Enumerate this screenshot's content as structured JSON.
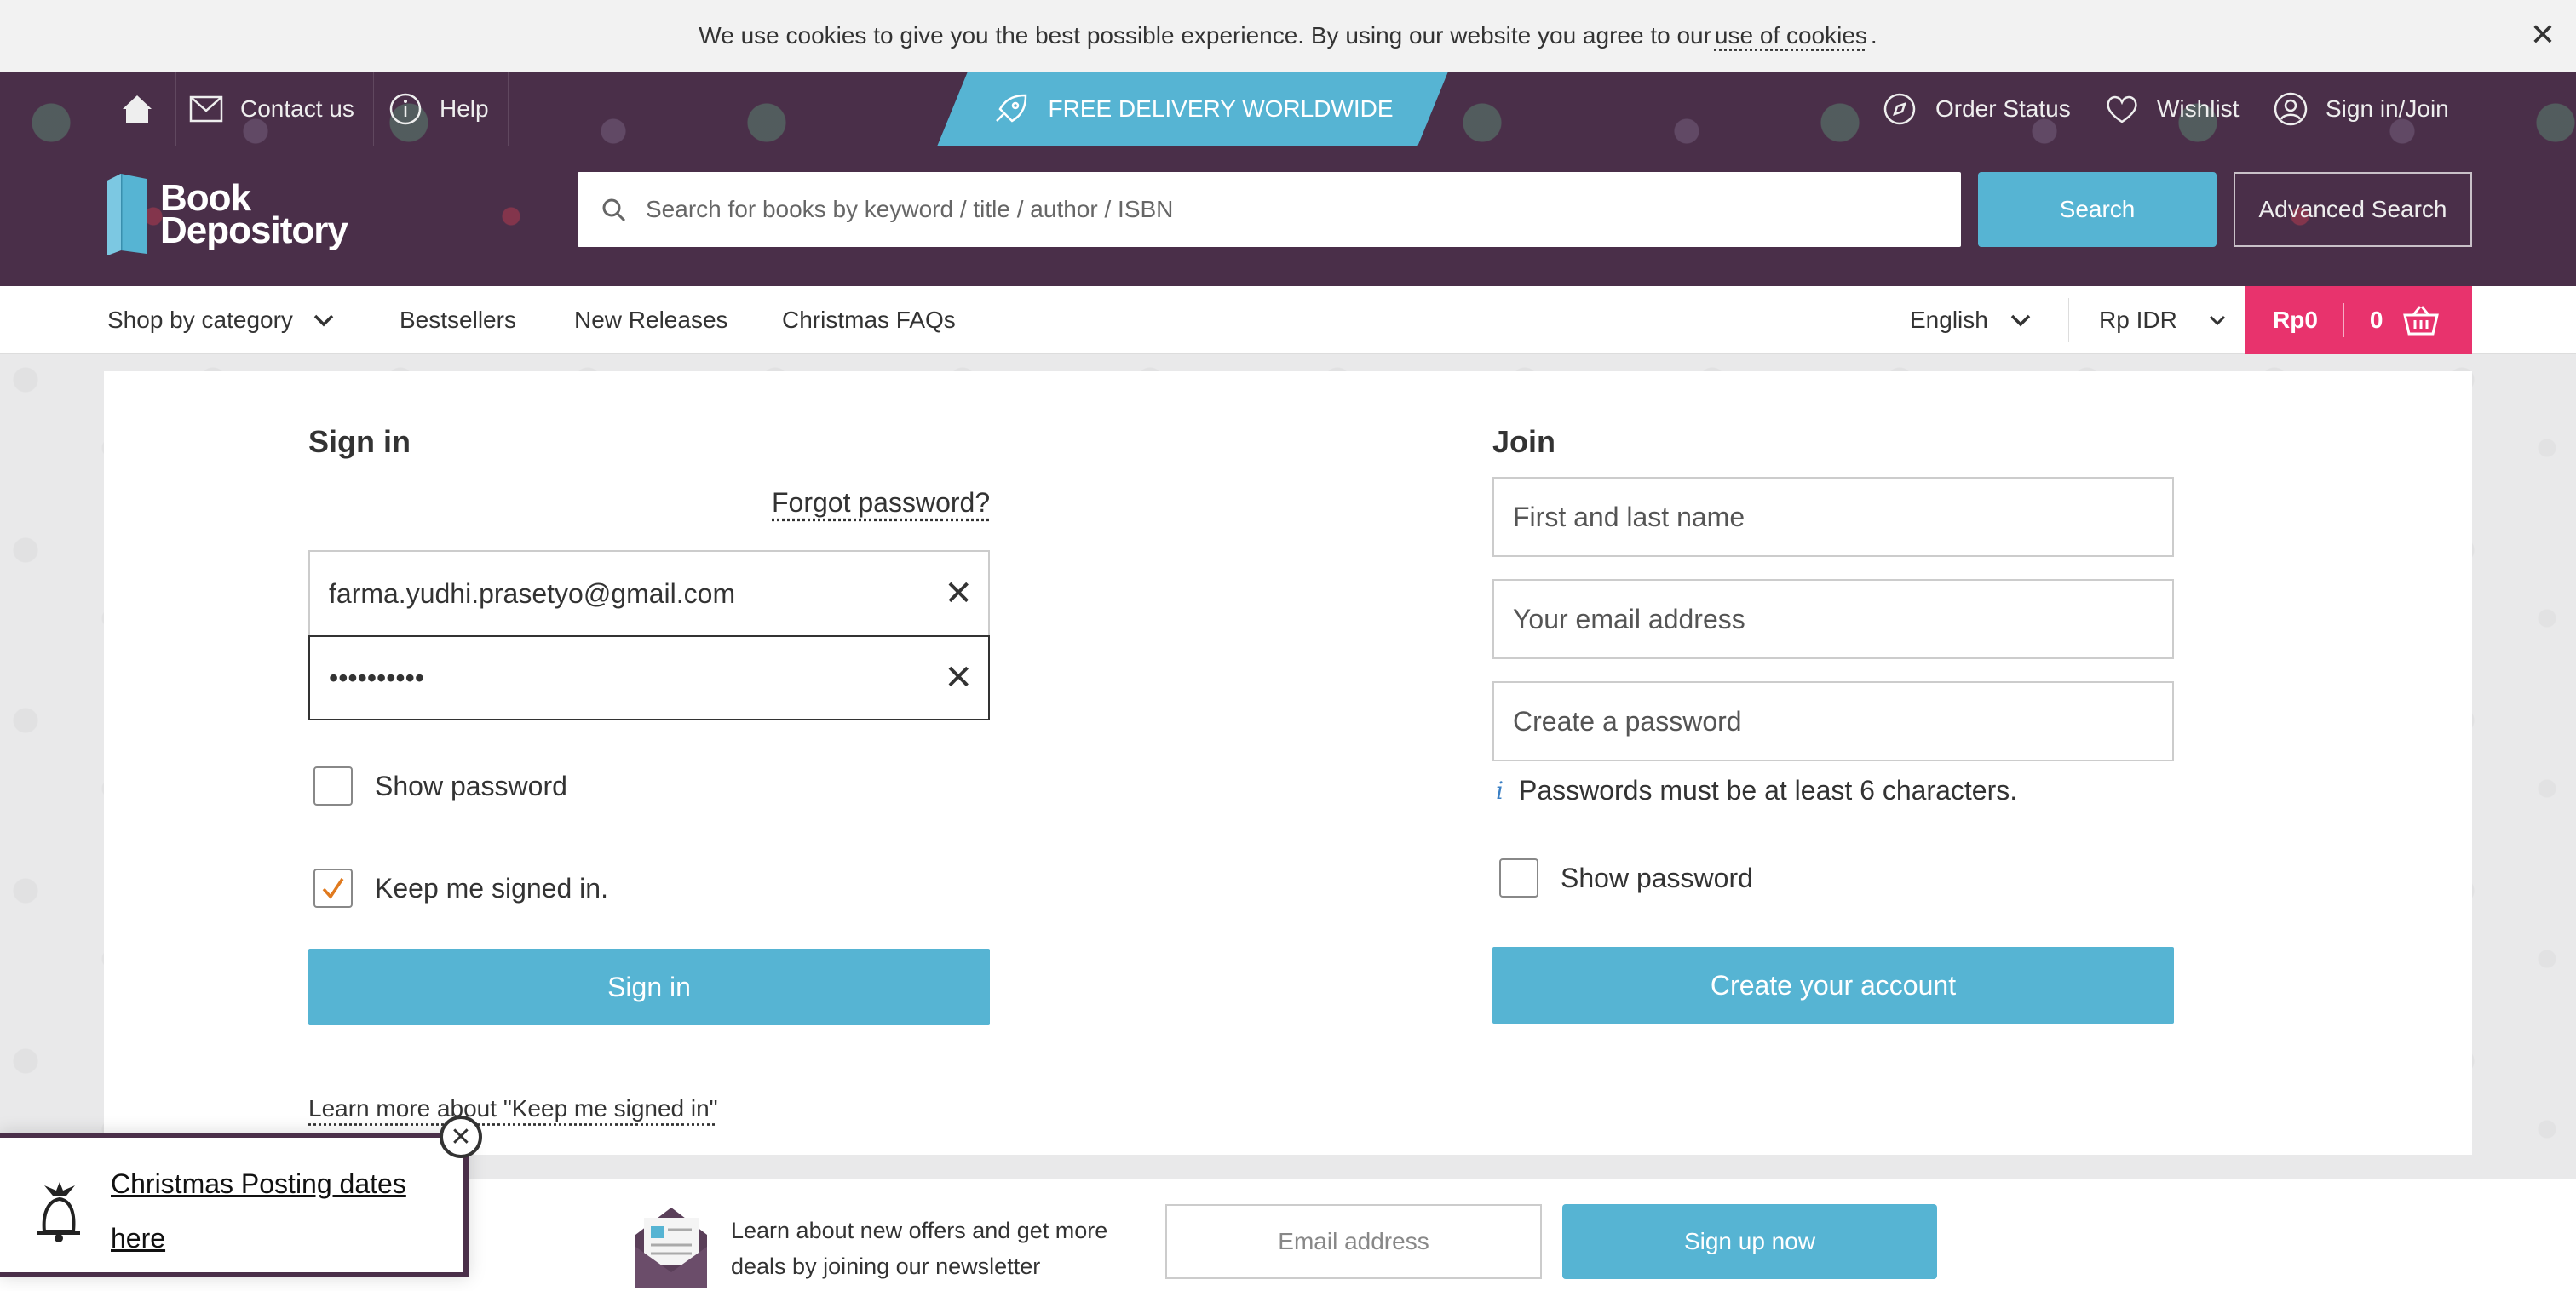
{
  "cookie_bar": {
    "text": "We use cookies to give you the best possible experience. By using our website you agree to our",
    "link": "use of cookies",
    "suffix": ".",
    "close": "✕"
  },
  "topbar": {
    "contact": "Contact us",
    "help": "Help",
    "delivery": "FREE DELIVERY WORLDWIDE",
    "order_status": "Order Status",
    "wishlist": "Wishlist",
    "signin_join": "Sign in/Join"
  },
  "logo": {
    "line1": "Book",
    "line2": "Depository"
  },
  "search": {
    "placeholder": "Search for books by keyword / title / author / ISBN",
    "button": "Search",
    "advanced": "Advanced Search"
  },
  "nav": {
    "shop_by_category": "Shop by category",
    "bestsellers": "Bestsellers",
    "new_releases": "New Releases",
    "christmas_faqs": "Christmas FAQs",
    "language": "English",
    "currency": "Rp IDR",
    "basket_total": "Rp0",
    "basket_count": "0"
  },
  "signin": {
    "title": "Sign in",
    "forgot": "Forgot password?",
    "email_value": "farma.yudhi.prasetyo@gmail.com",
    "password_value": "••••••••••",
    "show_password": "Show password",
    "keep_signed_in": "Keep me signed in.",
    "button": "Sign in",
    "learn_more": "Learn more about \"Keep me signed in\"",
    "clear": "✕"
  },
  "join": {
    "title": "Join",
    "name_placeholder": "First and last name",
    "email_placeholder": "Your email address",
    "password_placeholder": "Create a password",
    "password_hint": "Passwords must be at least 6 characters.",
    "hint_icon": "i",
    "show_password": "Show password",
    "button": "Create your account"
  },
  "newsletter": {
    "text": "Learn about new offers and get more deals by joining our newsletter",
    "placeholder": "Email address",
    "button": "Sign up now"
  },
  "xmas_popup": {
    "link": "Christmas Posting dates here",
    "close": "✕"
  },
  "colors": {
    "header_bg": "#4a2f49",
    "accent_blue": "#56b4d3",
    "basket_pink": "#e8336d",
    "checkmark": "#e07a1f"
  }
}
